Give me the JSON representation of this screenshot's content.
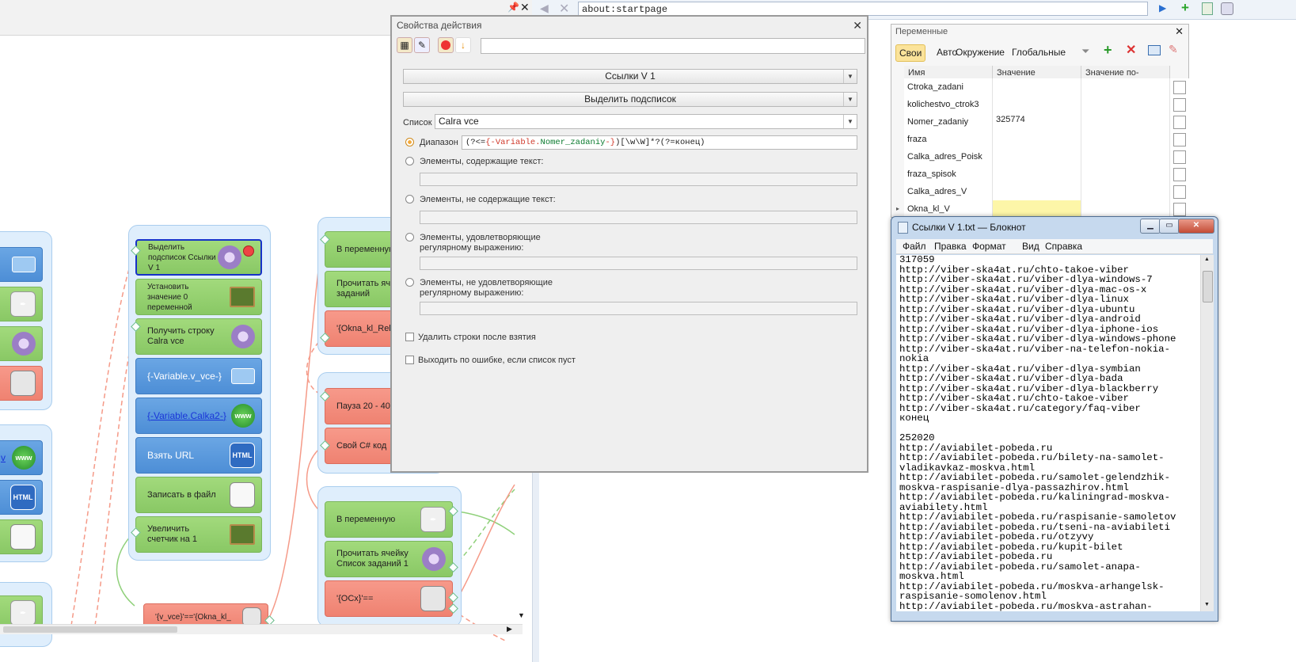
{
  "browser": {
    "url": "about:startpage"
  },
  "canvas": {
    "left_column": {
      "nodes": [
        "v"
      ]
    },
    "group1": {
      "nodes": [
        {
          "label": "Выделить подсписок Ссылки V 1"
        },
        {
          "label": "Установить значение 0 переменной"
        },
        {
          "label": "Получить строку Calra vce"
        },
        {
          "label": "{-Variable.v_vce-}"
        },
        {
          "label": "{-Variable.Calka2-}"
        },
        {
          "label": "Взять URL"
        },
        {
          "label": "Записать в файл"
        },
        {
          "label": "Увеличить счетчик на 1"
        }
      ]
    },
    "group2": {
      "nodes": [
        {
          "label": "В переменную"
        },
        {
          "label": "Прочитать ячейку Список заданий"
        },
        {
          "label": "'{Okna_kl_Rek}'"
        }
      ]
    },
    "group3": {
      "nodes": [
        {
          "label": "Пауза 20 - 40"
        },
        {
          "label": "Свой C# код"
        }
      ]
    },
    "group4": {
      "nodes": [
        {
          "label": "В переменную"
        },
        {
          "label": "Прочитать ячейку Список заданий 1"
        },
        {
          "label": "'{OCx}'=="
        }
      ]
    },
    "bottom_node": "'{v_vce}'=='{Okna_kl_"
  },
  "props": {
    "title": "Свойства действия",
    "combo1": "Ссылки V 1",
    "combo2": "Выделить подсписок",
    "list_label": "Список",
    "list_value": "Calra vce",
    "range_label": "Диапазон",
    "range_prefix": "(?<=",
    "range_var_open": "{-Variable.",
    "range_var_name": "Nomer_zadaniy",
    "range_var_close": "-}",
    "range_suffix": ")[\\w\\W]*?(?=конец)",
    "opt_contains": "Элементы, содержащие текст:",
    "opt_not_contains": "Элементы, не содержащие текст:",
    "opt_regex": "Элементы, удовлетворяющие регулярному выражению:",
    "opt_not_regex": "Элементы, не удовлетворяющие регулярному выражению:",
    "chk_delete": "Удалить строки после взятия",
    "chk_exit": "Выходить по ошибке, если список пуст"
  },
  "variables": {
    "title": "Переменные",
    "tabs": [
      "Свои",
      "Авто",
      "Окружение",
      "Глобальные"
    ],
    "columns": [
      "Имя",
      "Значение",
      "Значение по-умолч..."
    ],
    "rows": [
      {
        "name": "Ctroka_zadani",
        "value": ""
      },
      {
        "name": "kolichestvo_ctrok3",
        "value": ""
      },
      {
        "name": "Nomer_zadaniy",
        "value": "325774"
      },
      {
        "name": "fraza",
        "value": ""
      },
      {
        "name": "Calka_adres_Poisk",
        "value": ""
      },
      {
        "name": "fraza_spisok",
        "value": ""
      },
      {
        "name": "Calka_adres_V",
        "value": ""
      },
      {
        "name": "Okna_kl_V",
        "value": ""
      }
    ]
  },
  "notepad": {
    "title": "Ссылки V 1.txt — Блокнот",
    "menu": [
      "Файл",
      "Правка",
      "Формат",
      "Вид",
      "Справка"
    ],
    "text": "317059\nhttp://viber-ska4at.ru/chto-takoe-viber\nhttp://viber-ska4at.ru/viber-dlya-windows-7\nhttp://viber-ska4at.ru/viber-dlya-mac-os-x\nhttp://viber-ska4at.ru/viber-dlya-linux\nhttp://viber-ska4at.ru/viber-dlya-ubuntu\nhttp://viber-ska4at.ru/viber-dlya-android\nhttp://viber-ska4at.ru/viber-dlya-iphone-ios\nhttp://viber-ska4at.ru/viber-dlya-windows-phone\nhttp://viber-ska4at.ru/viber-na-telefon-nokia-\nnokia\nhttp://viber-ska4at.ru/viber-dlya-symbian\nhttp://viber-ska4at.ru/viber-dlya-bada\nhttp://viber-ska4at.ru/viber-dlya-blackberry\nhttp://viber-ska4at.ru/chto-takoe-viber\nhttp://viber-ska4at.ru/category/faq-viber\nконец\n\n252020\nhttp://aviabilet-pobeda.ru\nhttp://aviabilet-pobeda.ru/bilety-na-samolet-\nvladikavkaz-moskva.html\nhttp://aviabilet-pobeda.ru/samolet-gelendzhik-\nmoskva-raspisanie-dlya-passazhirov.html\nhttp://aviabilet-pobeda.ru/kaliningrad-moskva-\naviabilety.html\nhttp://aviabilet-pobeda.ru/raspisanie-samoletov\nhttp://aviabilet-pobeda.ru/tseni-na-aviabileti\nhttp://aviabilet-pobeda.ru/otzyvy\nhttp://aviabilet-pobeda.ru/kupit-bilet\nhttp://aviabilet-pobeda.ru\nhttp://aviabilet-pobeda.ru/samolet-anapa-\nmoskva.html\nhttp://aviabilet-pobeda.ru/moskva-arhangelsk-\nraspisanie-somolenov.html\nhttp://aviabilet-pobeda.ru/moskva-astrahan-"
  }
}
